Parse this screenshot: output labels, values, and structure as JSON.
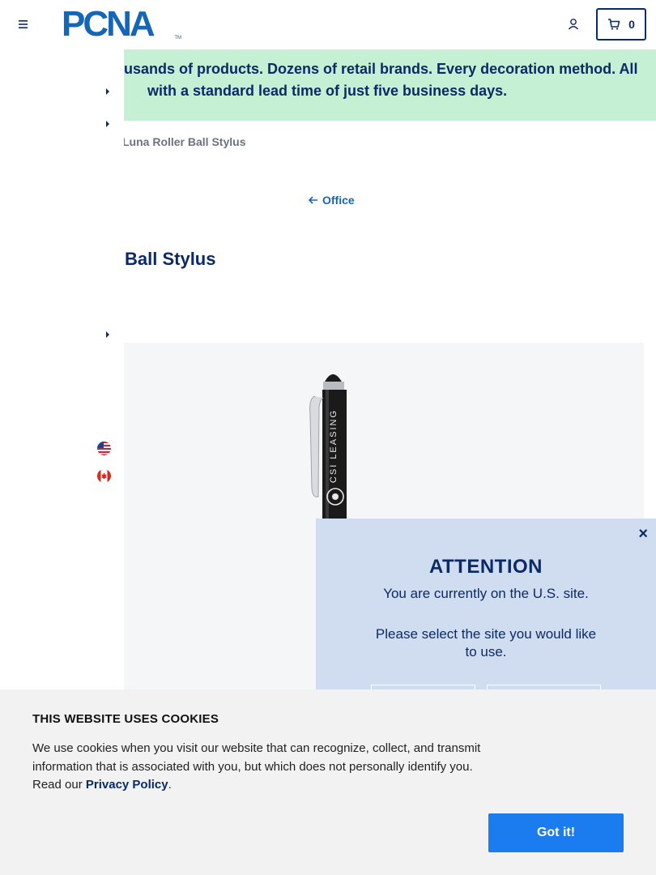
{
  "header": {
    "logo_text": "PCNA",
    "logo_tm": "TM",
    "cart_count": "0"
  },
  "banner": {
    "line1": "usands of products. Dozens of retail brands. Every decoration method. All",
    "line2": "with a standard lead time of just five business days."
  },
  "breadcrumb": {
    "current": "Luna Roller Ball Stylus"
  },
  "back_link": {
    "label": "Office"
  },
  "product": {
    "title": "Ball Stylus",
    "imprint_text": "CSI LEASING"
  },
  "attention": {
    "title": "ATTENTION",
    "message": "You are currently on the U.S. site.",
    "question": "Please select the site you would like to use.",
    "close_label": "×"
  },
  "cookie": {
    "title": "THIS WEBSITE USES COOKIES",
    "text_before": "We use cookies when you visit our website that can recognize, collect, and transmit information that is associated with you, but which does not personally identify you. Read our ",
    "link": "Privacy Policy",
    "text_after": ".",
    "button": "Got it!"
  },
  "colors": {
    "navy": "#0b2a66",
    "brand_blue": "#1566b6",
    "banner_green": "#c5f0d3",
    "popup_blue": "#d0dcf0",
    "cookie_button": "#1b7cf0"
  },
  "icons": [
    "hamburger-menu-icon",
    "account-icon",
    "cart-icon",
    "caret-right-icon",
    "arrow-left-icon",
    "us-flag-icon",
    "canada-flag-icon",
    "close-icon"
  ]
}
